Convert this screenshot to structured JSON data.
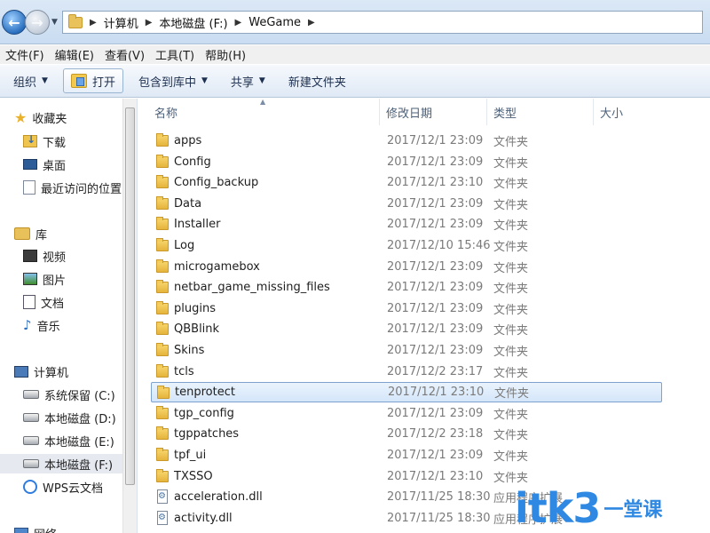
{
  "address": {
    "breadcrumbs": [
      "计算机",
      "本地磁盘 (F:)",
      "WeGame"
    ]
  },
  "menu": [
    "文件(F)",
    "编辑(E)",
    "查看(V)",
    "工具(T)",
    "帮助(H)"
  ],
  "toolbar": {
    "organize": "组织",
    "open": "打开",
    "include_in_library": "包含到库中",
    "share": "共享",
    "new_folder": "新建文件夹"
  },
  "nav": {
    "favorites": "收藏夹",
    "downloads": "下载",
    "desktop": "桌面",
    "recent": "最近访问的位置",
    "libraries": "库",
    "videos": "视频",
    "pictures": "图片",
    "documents": "文档",
    "music": "音乐",
    "computer": "计算机",
    "drive_c": "系统保留 (C:)",
    "drive_d": "本地磁盘 (D:)",
    "drive_e": "本地磁盘 (E:)",
    "drive_f": "本地磁盘 (F:)",
    "wps": "WPS云文档",
    "network": "网络"
  },
  "columns": {
    "name": "名称",
    "modified": "修改日期",
    "type": "类型",
    "size": "大小"
  },
  "files": [
    {
      "name": "apps",
      "date": "2017/12/1 23:09",
      "type": "文件夹",
      "kind": "folder"
    },
    {
      "name": "Config",
      "date": "2017/12/1 23:09",
      "type": "文件夹",
      "kind": "folder"
    },
    {
      "name": "Config_backup",
      "date": "2017/12/1 23:10",
      "type": "文件夹",
      "kind": "folder"
    },
    {
      "name": "Data",
      "date": "2017/12/1 23:09",
      "type": "文件夹",
      "kind": "folder"
    },
    {
      "name": "Installer",
      "date": "2017/12/1 23:09",
      "type": "文件夹",
      "kind": "folder"
    },
    {
      "name": "Log",
      "date": "2017/12/10 15:46",
      "type": "文件夹",
      "kind": "folder"
    },
    {
      "name": "microgamebox",
      "date": "2017/12/1 23:09",
      "type": "文件夹",
      "kind": "folder"
    },
    {
      "name": "netbar_game_missing_files",
      "date": "2017/12/1 23:09",
      "type": "文件夹",
      "kind": "folder"
    },
    {
      "name": "plugins",
      "date": "2017/12/1 23:09",
      "type": "文件夹",
      "kind": "folder"
    },
    {
      "name": "QBBlink",
      "date": "2017/12/1 23:09",
      "type": "文件夹",
      "kind": "folder"
    },
    {
      "name": "Skins",
      "date": "2017/12/1 23:09",
      "type": "文件夹",
      "kind": "folder"
    },
    {
      "name": "tcls",
      "date": "2017/12/2 23:17",
      "type": "文件夹",
      "kind": "folder"
    },
    {
      "name": "tenprotect",
      "date": "2017/12/1 23:10",
      "type": "文件夹",
      "kind": "folder",
      "selected": true
    },
    {
      "name": "tgp_config",
      "date": "2017/12/1 23:09",
      "type": "文件夹",
      "kind": "folder"
    },
    {
      "name": "tgppatches",
      "date": "2017/12/2 23:18",
      "type": "文件夹",
      "kind": "folder"
    },
    {
      "name": "tpf_ui",
      "date": "2017/12/1 23:09",
      "type": "文件夹",
      "kind": "folder"
    },
    {
      "name": "TXSSO",
      "date": "2017/12/1 23:10",
      "type": "文件夹",
      "kind": "folder"
    },
    {
      "name": "acceleration.dll",
      "date": "2017/11/25 18:30",
      "type": "应用程序扩展",
      "kind": "dll"
    },
    {
      "name": "activity.dll",
      "date": "2017/11/25 18:30",
      "type": "应用程序扩展",
      "kind": "dll"
    }
  ],
  "watermark": {
    "main": "itk3",
    "sub": "一堂课"
  }
}
